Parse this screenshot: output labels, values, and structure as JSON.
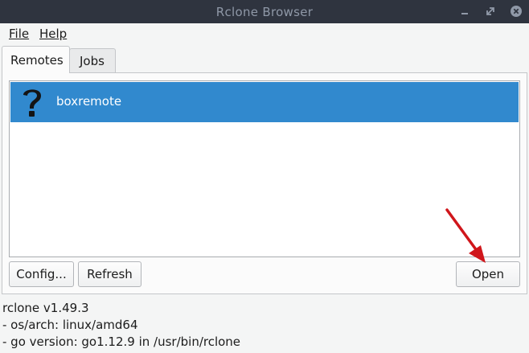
{
  "window": {
    "title": "Rclone Browser"
  },
  "menu": {
    "file": "File",
    "help": "Help"
  },
  "tabs": [
    {
      "label": "Remotes",
      "active": true
    },
    {
      "label": "Jobs",
      "active": false
    }
  ],
  "remotes": {
    "items": [
      {
        "name": "boxremote",
        "icon": "question-mark-icon",
        "selected": true
      }
    ],
    "selection_color": "#3189ce"
  },
  "buttons": {
    "config": "Config...",
    "refresh": "Refresh",
    "open": "Open"
  },
  "status": {
    "lines": [
      "rclone v1.49.3",
      "- os/arch: linux/amd64",
      "- go version: go1.12.9 in /usr/bin/rclone"
    ]
  },
  "annotation": {
    "icon": "red-arrow-icon",
    "color": "#d0161b"
  }
}
